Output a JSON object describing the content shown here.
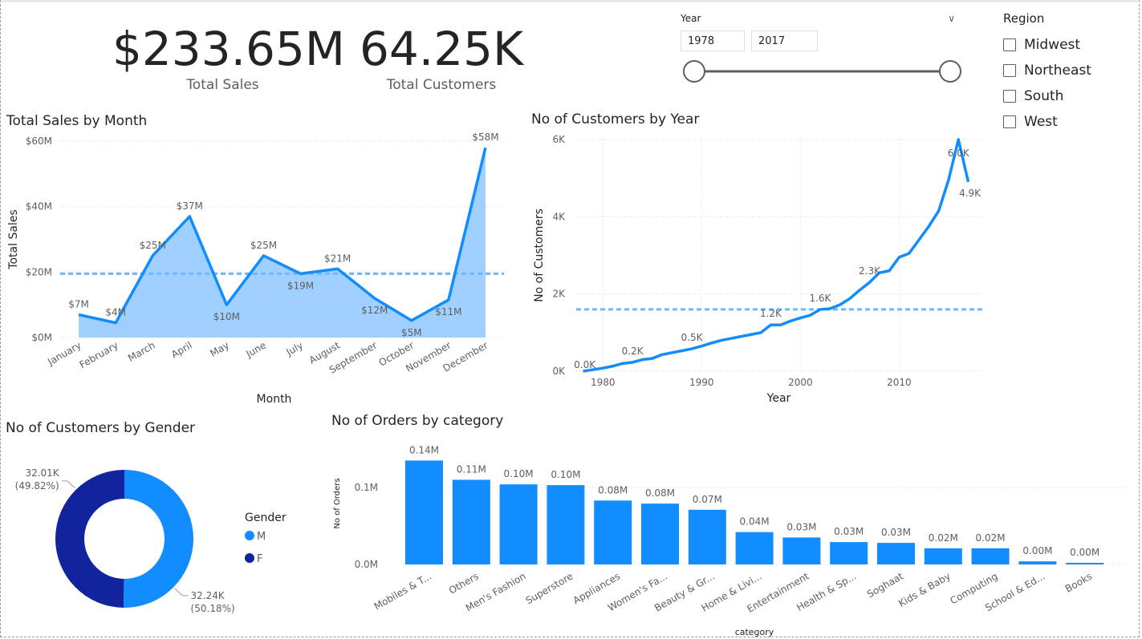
{
  "kpis": [
    {
      "value": "$233.65M",
      "label": "Total Sales"
    },
    {
      "value": "64.25K",
      "label": "Total Customers"
    }
  ],
  "year_slicer": {
    "title": "Year",
    "from": "1978",
    "to": "2017"
  },
  "region_slicer": {
    "title": "Region",
    "options": [
      "Midwest",
      "Northeast",
      "South",
      "West"
    ]
  },
  "accent_color": "#118DFF",
  "chart_data": [
    {
      "id": "sales_by_month",
      "type": "area",
      "title": "Total Sales by Month",
      "xlabel": "Month",
      "ylabel": "Total Sales",
      "categories": [
        "January",
        "February",
        "March",
        "April",
        "May",
        "June",
        "July",
        "August",
        "September",
        "October",
        "November",
        "December"
      ],
      "values": [
        7,
        4.5,
        25,
        37,
        10,
        25,
        19.5,
        21,
        12,
        5.2,
        11.5,
        58
      ],
      "data_labels": [
        "$7M",
        "$4M",
        "$25M",
        "$37M",
        "$10M",
        "$25M",
        "$19M",
        "$21M",
        "$12M",
        "$5M",
        "$11M",
        "$58M"
      ],
      "y_ticks": [
        "$0M",
        "$20M",
        "$40M",
        "$60M"
      ],
      "ylim": [
        0,
        60
      ],
      "average_line": 19.5,
      "grid": true,
      "line_color": "#118DFF",
      "fill_color": "#A0D0FF"
    },
    {
      "id": "customers_by_year",
      "type": "line",
      "title": "No of Customers by Year",
      "xlabel": "Year",
      "ylabel": "No of Customers",
      "x": [
        1978,
        1979,
        1980,
        1981,
        1982,
        1983,
        1984,
        1985,
        1986,
        1987,
        1988,
        1989,
        1990,
        1991,
        1992,
        1993,
        1994,
        1995,
        1996,
        1997,
        1998,
        1999,
        2000,
        2001,
        2002,
        2003,
        2004,
        2005,
        2006,
        2007,
        2008,
        2009,
        2010,
        2011,
        2012,
        2013,
        2014,
        2015,
        2016,
        2017
      ],
      "y": [
        0,
        0.04,
        0.08,
        0.13,
        0.2,
        0.23,
        0.3,
        0.33,
        0.43,
        0.48,
        0.53,
        0.58,
        0.65,
        0.73,
        0.8,
        0.85,
        0.9,
        0.95,
        1.0,
        1.2,
        1.2,
        1.3,
        1.38,
        1.45,
        1.6,
        1.62,
        1.72,
        1.88,
        2.1,
        2.3,
        2.55,
        2.6,
        2.95,
        3.05,
        3.4,
        3.75,
        4.15,
        4.95,
        6.0,
        4.9
      ],
      "data_labels": [
        {
          "x": 1978,
          "text": "0.0K"
        },
        {
          "x": 1983,
          "text": "0.2K"
        },
        {
          "x": 1989,
          "text": "0.5K"
        },
        {
          "x": 1997,
          "text": "1.2K"
        },
        {
          "x": 2002,
          "text": "1.6K"
        },
        {
          "x": 2007,
          "text": "2.3K"
        },
        {
          "x": 2016,
          "text": "6.0K"
        },
        {
          "x": 2017,
          "text": "4.9K"
        }
      ],
      "x_ticks": [
        "1980",
        "1990",
        "2000",
        "2010"
      ],
      "y_ticks": [
        "0K",
        "2K",
        "4K",
        "6K"
      ],
      "ylim": [
        0,
        6
      ],
      "xlim": [
        1977.3,
        2018.5
      ],
      "average_line": 1.6,
      "grid": true,
      "line_color": "#118DFF"
    },
    {
      "id": "customers_by_gender",
      "type": "pie",
      "donut": true,
      "title": "No of Customers by Gender",
      "legend_title": "Gender",
      "labels": [
        "M",
        "F"
      ],
      "values": [
        32.24,
        32.01
      ],
      "data_labels": [
        [
          "32.24K",
          "(50.18%)"
        ],
        [
          "32.01K",
          "(49.82%)"
        ]
      ],
      "colors": [
        "#118DFF",
        "#12239E"
      ],
      "legend_position": "right"
    },
    {
      "id": "orders_by_category",
      "type": "bar",
      "title": "No of Orders by category",
      "xlabel": "category",
      "ylabel": "No of Orders",
      "categories": [
        "Mobiles & T...",
        "Others",
        "Men's Fashion",
        "Superstore",
        "Appliances",
        "Women's Fa...",
        "Beauty & Gr...",
        "Home & Livi...",
        "Entertainment",
        "Health & Sp...",
        "Soghaat",
        "Kids & Baby",
        "Computing",
        "School & Ed...",
        "Books"
      ],
      "values": [
        0.135,
        0.11,
        0.104,
        0.103,
        0.083,
        0.079,
        0.071,
        0.042,
        0.035,
        0.029,
        0.028,
        0.021,
        0.021,
        0.004,
        0.002
      ],
      "data_labels": [
        "0.14M",
        "0.11M",
        "0.10M",
        "0.10M",
        "0.08M",
        "0.08M",
        "0.07M",
        "0.04M",
        "0.03M",
        "0.03M",
        "0.03M",
        "0.02M",
        "0.02M",
        "0.00M",
        "0.00M"
      ],
      "y_ticks": [
        "0.0M",
        "0.1M"
      ],
      "ylim": [
        0,
        0.15
      ],
      "grid": true,
      "bar_color": "#118DFF"
    }
  ]
}
